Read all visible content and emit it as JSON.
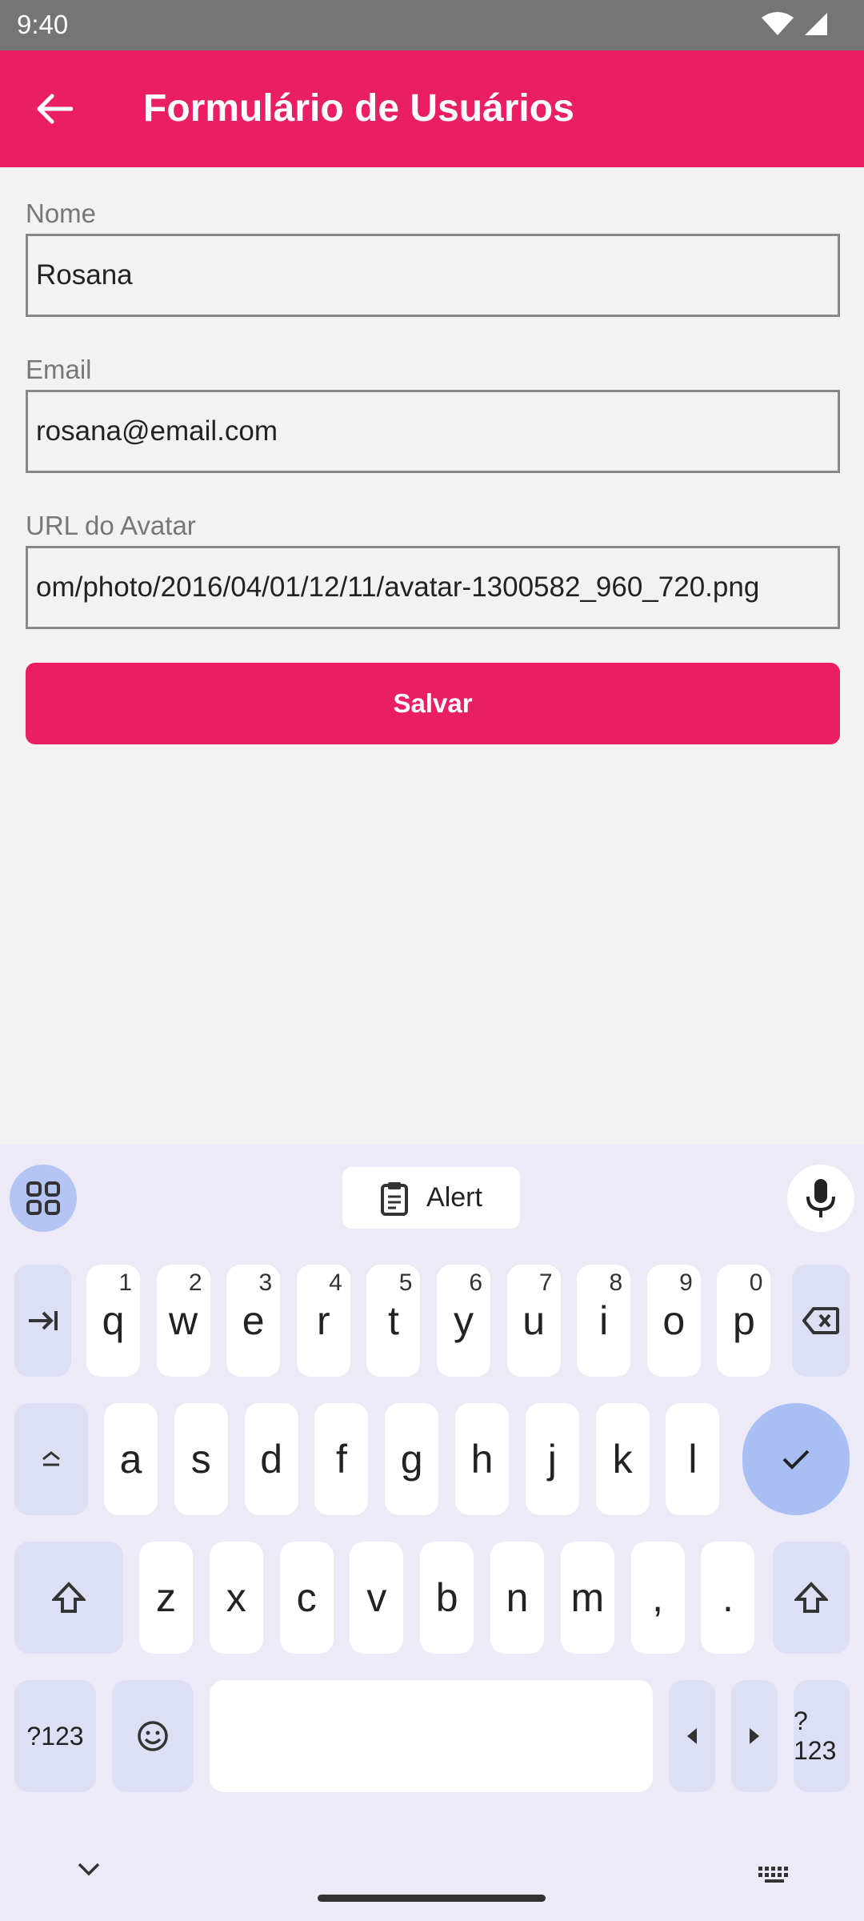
{
  "status_bar": {
    "time": "9:40"
  },
  "app_bar": {
    "title": "Formulário de Usuários"
  },
  "form": {
    "name": {
      "label": "Nome",
      "value": "Rosana"
    },
    "email": {
      "label": "Email",
      "value": "rosana@email.com"
    },
    "avatar": {
      "label": "URL do Avatar",
      "value": "om/photo/2016/04/01/12/11/avatar-1300582_960_720.png"
    },
    "save_label": "Salvar"
  },
  "keyboard": {
    "clipboard_label": "Alert",
    "row1": [
      {
        "k": "q",
        "h": "1"
      },
      {
        "k": "w",
        "h": "2"
      },
      {
        "k": "e",
        "h": "3"
      },
      {
        "k": "r",
        "h": "4"
      },
      {
        "k": "t",
        "h": "5"
      },
      {
        "k": "y",
        "h": "6"
      },
      {
        "k": "u",
        "h": "7"
      },
      {
        "k": "i",
        "h": "8"
      },
      {
        "k": "o",
        "h": "9"
      },
      {
        "k": "p",
        "h": "0"
      }
    ],
    "row2": [
      "a",
      "s",
      "d",
      "f",
      "g",
      "h",
      "j",
      "k",
      "l"
    ],
    "row3": [
      "z",
      "x",
      "c",
      "v",
      "b",
      "n",
      "m",
      ",",
      "."
    ],
    "symbols_label": "?123",
    "symbols_label_right": "?123"
  }
}
